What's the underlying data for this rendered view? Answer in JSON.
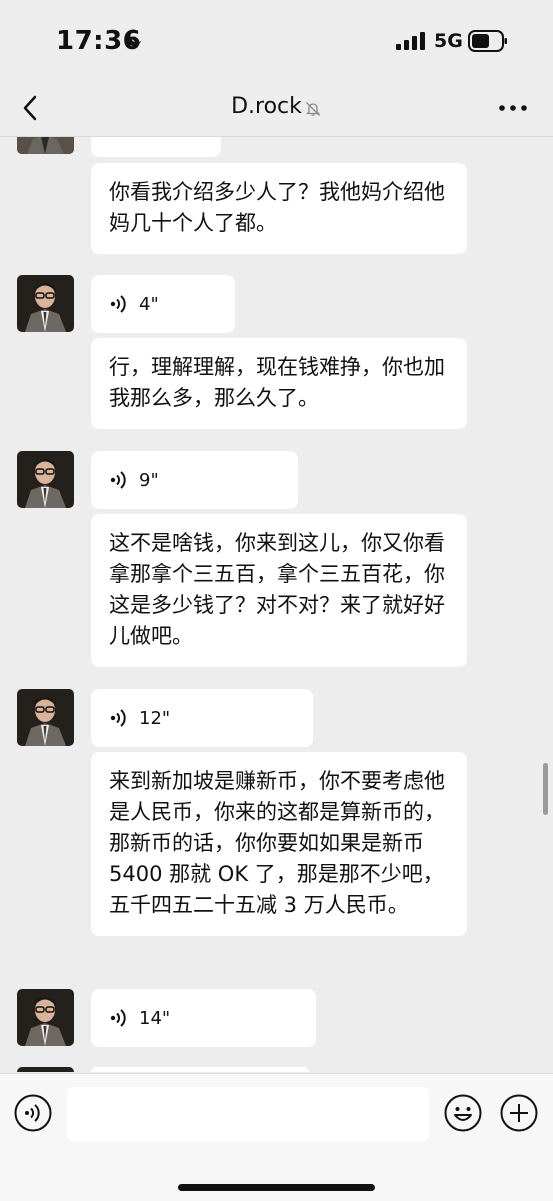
{
  "status_bar": {
    "time": "17:36",
    "network": "5G"
  },
  "header": {
    "title": "D.rock"
  },
  "messages": {
    "text_1": "你看我介绍多少人了？我他妈介绍他妈几十个人了都。",
    "voice_1": "4\"",
    "text_2": "行，理解理解，现在钱难挣，你也加我那么多，那么久了。",
    "voice_2": "9\"",
    "text_3": "这不是啥钱，你来到这儿，你又你看拿那拿个三五百，拿个三五百花，你这是多少钱了？对不对？来了就好好儿做吧。",
    "voice_3": "12\"",
    "text_4": "来到新加坡是赚新币，你不要考虑他是人民币，你来的这都是算新币的，那新币的话，你你要如如果是新币 5400 那就 OK 了，那是那不少吧，五千四五二十五减 3 万人民币。",
    "voice_4": "14\""
  },
  "colors": {
    "background": "#ededed",
    "bubble": "#ffffff",
    "text": "#111111"
  },
  "icons": [
    "moon-icon",
    "signal-icon",
    "battery-icon",
    "back-icon",
    "mute-icon",
    "more-icon",
    "voice-icon",
    "emoji-icon",
    "plus-icon"
  ]
}
